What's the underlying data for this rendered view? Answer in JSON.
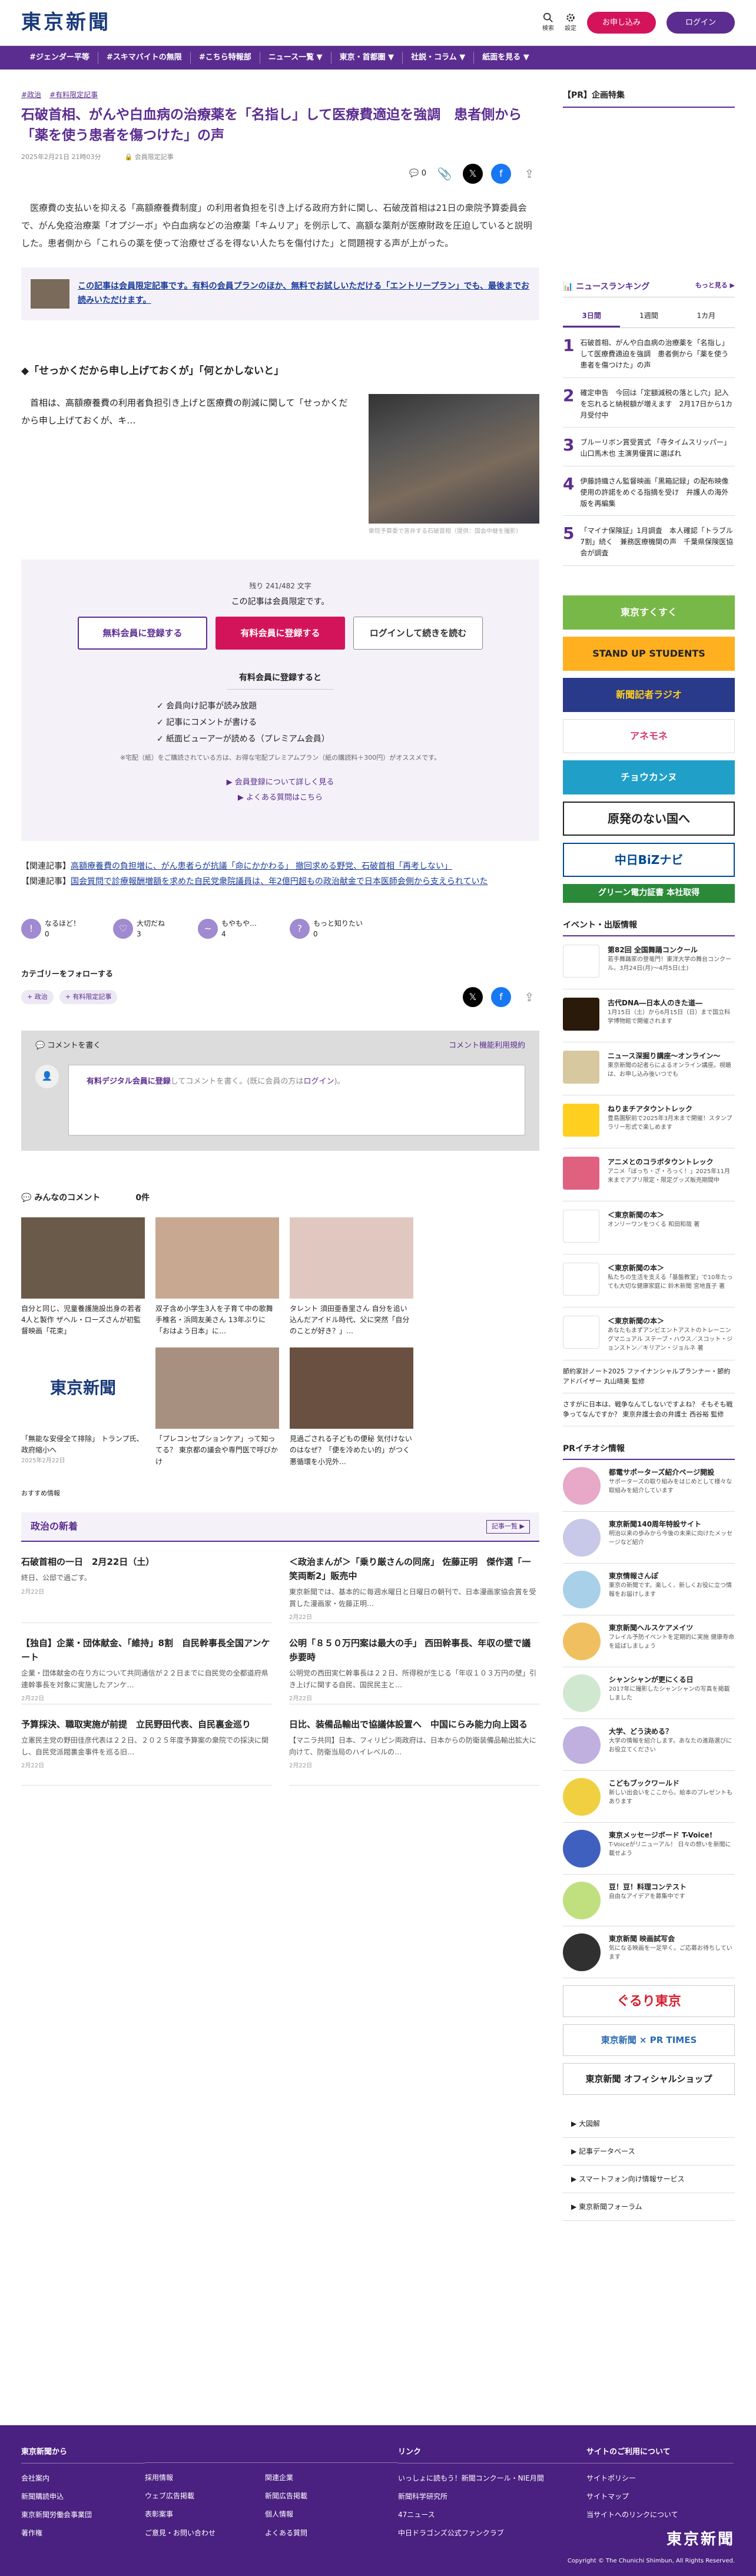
{
  "site": {
    "logo": "東京新聞",
    "search": "検索",
    "settings": "設定",
    "subscribe": "お申し込み",
    "login": "ログイン"
  },
  "nav": [
    "#ジェンダー平等",
    "#スキマバイトの無限",
    "#こちら特報部",
    "ニュース一覧 ▼",
    "東京・首都圏 ▼",
    "社説・コラム ▼",
    "紙面を見る ▼"
  ],
  "article": {
    "tags": [
      "#政治",
      "#有料限定記事"
    ],
    "title": "石破首相、がんや白血病の治療薬を「名指し」して医療費適迫を強調　患者側から「薬を使う患者を傷つけた」の声",
    "date": "2025年2月21日 21時03分",
    "badge": "会員限定記事",
    "comments": "0",
    "lead": "医療費の支払いを抑える「高額療養費制度」の利用者負担を引き上げる政府方針に関し、石破茂首相は21日の衆院予算委員会で、がん免疫治療薬「オプジーボ」や白血病などの治療薬「キムリア」を例示して、高額な薬剤が医療財政を圧迫していると説明した。患者側から「これらの薬を使って治療せざるを得ない人たちを傷付けた」と問題視する声が上がった。",
    "promo": "この記事は会員限定記事です。有料の会員プランのほか、無料でお試しいただける「エントリープラン」でも、最後までお読みいただけます。",
    "h2": "「せっかくだから申し上げておくが」「何とかしないと」",
    "body2": "首相は、高額療養費の利用者負担引き上げと医療費の削減に関して「せっかくだから申し上げておくが、キ…",
    "caption": "衆院予算委で答弁する石破首相（提供：国会中継を撮影）"
  },
  "paywall": {
    "remaining": "残り 241/482 文字",
    "limited": "この記事は会員限定です。",
    "free_reg": "無料会員に登録する",
    "paid_reg": "有料会員に登録する",
    "login": "ログインして続きを読む",
    "benefit_h": "有料会員に登録すると",
    "benefits": [
      "✓ 会員向け記事が読み放題",
      "✓ 記事にコメントが書ける",
      "✓ 紙面ビューアーが読める（プレミアム会員）"
    ],
    "note": "※宅配（紙）をご購読されている方は、お得な宅配プレミアムプラン（紙の購読料＋300円）がオススメです。",
    "link1": "▶ 会員登録について詳しく見る",
    "link2": "▶ よくある質問はこちら"
  },
  "related": [
    {
      "prefix": "【関連記事】",
      "text": "高額療養費の負担増に、がん患者らが抗議「命にかかわる」 撤回求める野党、石破首相「再考しない」"
    },
    {
      "prefix": "【関連記事】",
      "text": "国会質問で診療報酬増額を求めた自民党衆院議員は、年2億円超もの政治献金で日本医師会側から支えられていた"
    }
  ],
  "reactions": [
    {
      "label": "なるほど！",
      "count": "0",
      "icon": "!"
    },
    {
      "label": "大切だね",
      "count": "3",
      "icon": "♡"
    },
    {
      "label": "もやもや…",
      "count": "4",
      "icon": "~"
    },
    {
      "label": "もっと知りたい",
      "count": "0",
      "icon": "?"
    }
  ],
  "category": {
    "heading": "カテゴリーをフォローする",
    "tags": [
      "+ 政治",
      "+ 有料限定記事"
    ]
  },
  "comment_box": {
    "title": "コメントを書く",
    "terms": "コメント機能利用規約",
    "placeholder_pre": "有料デジタル会員に登録",
    "placeholder_mid": "してコメントを書く。(既に会員の方は",
    "placeholder_login": "ログイン",
    "placeholder_post": ")。"
  },
  "comment_count": {
    "label": "みんなのコメント",
    "count": "0件"
  },
  "cards": [
    {
      "text": "自分と同じ、児童養護施設出身の若者4人と製作 ザヘル・ローズさんが初監督映画「花束」",
      "date": "",
      "color": "#6a5a4a"
    },
    {
      "text": "双子含め小学生3人を子育て中の歌舞手椎名・浜岡友美さん 13年ぶりに「おはよう日本」に…",
      "date": "",
      "color": "#c8a890"
    },
    {
      "text": "タレント 須田亜香里さん 自分を追い込んだアイドル時代、父に突然「自分のことが好き？」…",
      "date": "",
      "color": "#e0c8c0"
    },
    {
      "text": "「無能な安侵全て排除」 トランプ氏、政府縮小へ",
      "date": "2025年2月22日",
      "color": "#ffffff"
    },
    {
      "text": "「プレコンセプションケア」って知ってる？ 東京都の議会や専門医で呼びかけ",
      "date": "",
      "color": "#a89080"
    },
    {
      "text": "見過ごされる子どもの便秘 気付けないのはなぜ？「便を冷めたい的」がつく悪循環を小児外…",
      "date": "",
      "color": "#6a5040"
    }
  ],
  "osusume": "おすすめ情報",
  "politics": {
    "heading": "政治の新着",
    "more": "記事一覧 ▶",
    "items": [
      {
        "title": "石破首相の一日　2月22日（土）",
        "desc": "終日、公邸で過ごす。",
        "date": "2月22日"
      },
      {
        "title": "＜政治まんが＞「乗り厳さんの同席」 佐藤正明　傑作選「一笑両断2」販売中",
        "desc": "東京新聞では、基本的に毎週水曜日と日曜日の朝刊で、日本漫画家協会賞を受賞した漫画家・佐藤正明…",
        "date": "2月22日"
      },
      {
        "title": "【独自】企業・団体献金、「維持」8割　自民幹事長全国アンケート",
        "desc": "企業・団体献金の在り方について共同通信が２２日までに自民党の全都道府県連幹事長を対象に実施したアンケ…",
        "date": "2月22日"
      },
      {
        "title": "公明「８５０万円案は最大の手」 西田幹事長、年収の壁で議歩要時",
        "desc": "公明党の西田実仁幹事長は２２日、所得税が生じる「年収１０３万円の壁」引き上げに関する自民、国民民主と…",
        "date": "2月22日"
      },
      {
        "title": "予算採決、職取実施が前提　立民野田代表、自民裏金巡り",
        "desc": "立憲民主党の野田佳彦代表は２２日、２０２５年度予算案の衆院での採決に関し、自民党派閥裏金事件を巡る旧…",
        "date": "2月22日"
      },
      {
        "title": "日比、装備品輸出で協議体設置へ　中国にらみ能力向上図る",
        "desc": "【マニラ共同】日本、フィリピン両政府は、日本からの防衛装備品輸出拡大に向けて、防衛当局のハイレベルの…",
        "date": "2月22日"
      }
    ]
  },
  "sidebar": {
    "pr": "【PR】企画特集",
    "ranking": "ニュースランキング",
    "more": "もっと見る ▶",
    "tabs": [
      "3日間",
      "1週間",
      "1カ月"
    ],
    "ranks": [
      {
        "n": "1",
        "t": "石破首相、がんや白血病の治療薬を「名指し」して医療費適迫を強調　患者側から「薬を使う患者を傷つけた」の声"
      },
      {
        "n": "2",
        "t": "確定申告　今回は「定額減税の落とし穴」記入を忘れると納税額が増えます　2月17日から1カ月受付中"
      },
      {
        "n": "3",
        "t": "ブルーリボン賞受賞式 「寺タイムスリッパー」山口馬木也 主演男優賞に選ばれ"
      },
      {
        "n": "4",
        "t": "伊藤詩織さん監督映画「黒箱記録」の配布映像使用の許諾をめぐる指摘を受け　弁護人の海外版を再編集"
      },
      {
        "n": "5",
        "t": "「マイナ保険証」1月調査　本人確認「トラブル7割」続く　兼務医療機関の声　千葉県保険医協会が調査"
      }
    ],
    "banners": [
      {
        "t": "東京すくすく",
        "c": "#78b848"
      },
      {
        "t": "STAND UP STUDENTS",
        "c": "#ffb020"
      },
      {
        "t": "新聞記者ラジオ",
        "c": "#2a3a8a"
      },
      {
        "t": "アネモネ",
        "c": "#d43870"
      },
      {
        "t": "チョウカンヌ",
        "c": "#20a0c8"
      },
      {
        "t": "原発のない国へ",
        "c": "#ffffff"
      },
      {
        "t": "中日BiZナビ",
        "c": "#004890"
      },
      {
        "t": "グリーン電力証書 本社取得",
        "c": "#2a8a3a"
      }
    ],
    "events_h": "イベント・出版情報",
    "events": [
      {
        "t": "第82回 全国舞踊コンクール",
        "d": "若手舞踊家の登竜門！東洋大学の舞台コンクール。3月24日(月)〜4月5日(土)",
        "c": "#fff"
      },
      {
        "t": "古代DNA―日本人のきた道―",
        "d": "1月15日（土）から6月15日（日）まで国立科学博物館で開催されます",
        "c": "#2a1a0a"
      },
      {
        "t": "ニュース深掘り講座〜オンライン〜",
        "d": "東京新聞の記者らによるオンライン講座。視聴は、お申し込み後いつでも",
        "c": "#d8c8a0"
      },
      {
        "t": "ねりまチアタウントレック",
        "d": "豊島園駅前で2025年3月末まで開催！スタンプラリー形式で楽しめます",
        "c": "#ffd020"
      },
      {
        "t": "アニメとのコラボタウントレック",
        "d": "アニメ「ぼっち・ざ・ろっく！」2025年11月末までアプリ限定・限定グッズ販売期間中",
        "c": "#e06080"
      },
      {
        "t": "＜東京新聞の本＞",
        "d": "オンリーワンをつくる 和田和哉 著",
        "c": "#fff"
      },
      {
        "t": "＜東京新聞の本＞",
        "d": "私たちの生活を支える「基盤教室」で10年たっても大切な健康家庭に 鈴木新聞 宮地直子 著",
        "c": "#fff"
      },
      {
        "t": "＜東京新聞の本＞",
        "d": "あなたもまずアンビエントアストのトレーニングマニュアル ステーブ・ハウス／スコット・ジョンストン／キリアン・ジョルネ 著",
        "c": "#fff"
      }
    ],
    "ev_text": [
      "節約家計ノート2025 ファイナンシャルプランナー・節約アドバイザー 丸山晴美 監修",
      "さすがに日本は、戦争なんてしないですよね？ そもそも戦争ってなんですか？ 東京弁護士会の弁護士 西谷裕 監修"
    ],
    "pr_h": "PRイチオシ情報",
    "prs": [
      {
        "t": "都電サポーターズ紹介ページ開設",
        "d": "サポーターズの取り組みをはじめとして様々な取組みを紹介しています",
        "c": "#e8a8c8"
      },
      {
        "t": "東京新聞140周年特設サイト",
        "d": "明治以来の歩みから今後の未来に向けたメッセージなど紹介",
        "c": "#c8c8e8"
      },
      {
        "t": "東京情報さんぽ",
        "d": "東京の新聞です。楽しく、新しくお役に立つ情報をお届けします",
        "c": "#a8d0e8"
      },
      {
        "t": "東京新聞ヘルスケアメイツ",
        "d": "フレイル予防イベントを定期的に実施 健康寿命を延ばしましょう",
        "c": "#f0c060"
      },
      {
        "t": "シャンシャンが更にくる日",
        "d": "2017年に撮影したシャンシャンの写真を掲載しました",
        "c": "#d0e8d0"
      },
      {
        "t": "大学、どう決める？",
        "d": "大学の情報を紹介します。あなたの進路選びにお役立てください",
        "c": "#c0b0e0"
      },
      {
        "t": "こどもブックワールド",
        "d": "新しい出会いをここから。絵本のプレゼントもあります",
        "c": "#f0d040"
      },
      {
        "t": "東京メッセージボード T-Voice!",
        "d": "T-Voiceがリニューアル！ 日々の想いを新聞に載せよう",
        "c": "#4060c0"
      },
      {
        "t": "豆！豆！料理コンテスト",
        "d": "自由なアイデアを募集中です",
        "c": "#c0e080"
      },
      {
        "t": "東京新聞 映画試写会",
        "d": "気になる映画を一足早く。ご応募お待ちしています",
        "c": "#303030"
      }
    ],
    "sbanners": [
      {
        "t": "ぐるり東京",
        "c": "#d42030"
      },
      {
        "t": "東京新聞 × PR TIMES",
        "c": "#2a6ab0"
      },
      {
        "t": "東京新聞 オフィシャルショップ",
        "c": "#222"
      }
    ],
    "links": [
      "▶ 大図解",
      "▶ 記事データベース",
      "▶ スマートフォン向け情報サービス",
      "▶ 東京新聞フォーラム"
    ]
  },
  "footer": {
    "cols": [
      {
        "h": "東京新聞から",
        "items": [
          "会社案内",
          "新聞購読申込",
          "東京新聞労働会事業団",
          "著作権"
        ]
      },
      {
        "h": "",
        "items": [
          "採用情報",
          "ウェブ広告掲載",
          "表彰案事",
          "ご意見・お問い合わせ"
        ]
      },
      {
        "h": "",
        "items": [
          "関連企業",
          "新聞広告掲載",
          "個人情報",
          "よくある質問"
        ]
      },
      {
        "h": "リンク",
        "items": [
          "いっしょに読もう！新聞コンクール・NIE月間",
          "新聞科学研究所",
          "47ニュース",
          "中日ドラゴンズ公式ファンクラブ"
        ]
      },
      {
        "h": "サイトのご利用について",
        "items": [
          "サイトポリシー",
          "サイトマップ",
          "当サイトへのリンクについて"
        ]
      }
    ],
    "logo": "東京新聞",
    "copyright": "Copyright © The Chunichi Shimbun, All Rights Reserved."
  }
}
